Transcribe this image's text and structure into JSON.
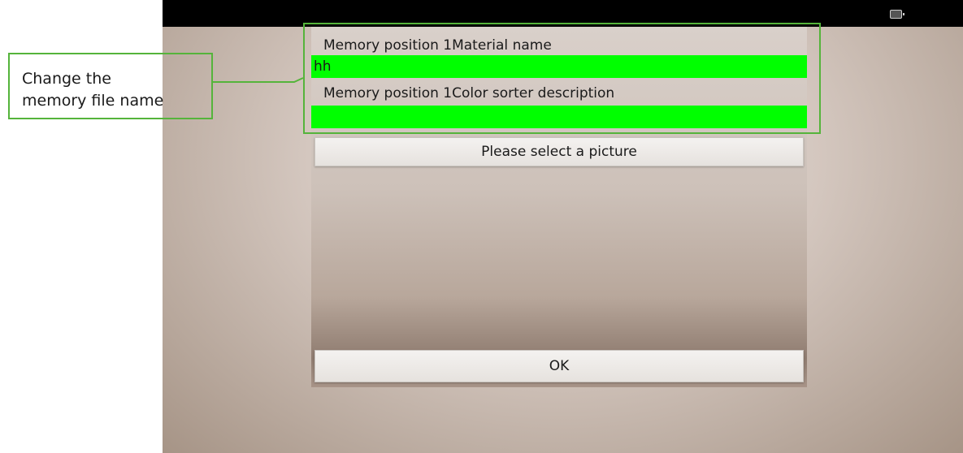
{
  "annotation": {
    "callout_text": "Change the\nmemory file name",
    "accent_color": "#55b43b"
  },
  "status_bar": {
    "icon": "battery-icon"
  },
  "dialog": {
    "material_name_label": "Memory position 1Material name",
    "material_name_value": "hh",
    "description_label": "Memory position 1Color sorter description",
    "description_value": "",
    "select_picture_label": "Please select a picture",
    "ok_label": "OK",
    "input_color": "#00ff00"
  }
}
